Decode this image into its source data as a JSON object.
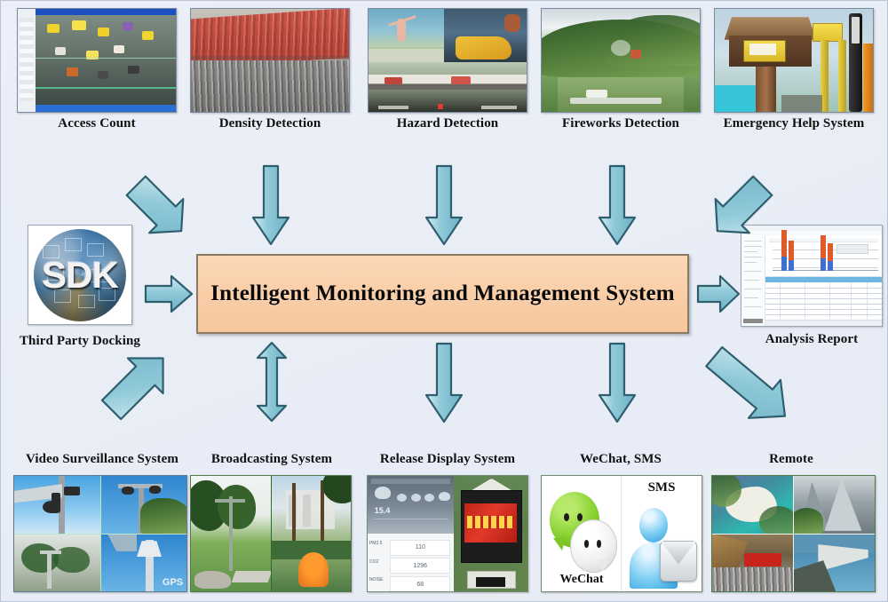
{
  "diagram": {
    "title": "Intelligent Monitoring and Management System",
    "center": {
      "label": "Intelligent Monitoring and Management System"
    },
    "colors": {
      "background": "#eceff7",
      "center_fill": "#f9cda6",
      "center_border": "#8a7a63",
      "arrow_fill": "#8fc9d8",
      "arrow_stroke": "#2f5f6e",
      "caption_text": "#111111",
      "panel_border": "#7a8aa0"
    },
    "top_row": [
      {
        "id": "access-count",
        "label": "Access Count"
      },
      {
        "id": "density-detection",
        "label": "Density Detection"
      },
      {
        "id": "hazard-detection",
        "label": "Hazard Detection"
      },
      {
        "id": "fireworks-detection",
        "label": "Fireworks Detection"
      },
      {
        "id": "emergency-help",
        "label": "Emergency Help System"
      }
    ],
    "left_node": {
      "id": "third-party-docking",
      "label": "Third Party Docking",
      "logo_text": "SDK"
    },
    "right_node": {
      "id": "analysis-report",
      "label": "Analysis Report"
    },
    "bottom_row": [
      {
        "id": "video-surveillance",
        "label": "Video Surveillance System"
      },
      {
        "id": "broadcasting",
        "label": "Broadcasting System"
      },
      {
        "id": "release-display",
        "label": "Release Display System"
      },
      {
        "id": "wechat-sms",
        "label": "WeChat, SMS"
      },
      {
        "id": "remote",
        "label": "Remote"
      }
    ],
    "wechat_panel": {
      "wechat_label": "WeChat",
      "sms_label": "SMS"
    },
    "release_panel": {
      "reading_1": "110",
      "reading_2": "1296",
      "reading_3": "68",
      "temp": "15.4"
    },
    "arrows": [
      {
        "id": "arrow-access-count-to-center",
        "from": "access-count",
        "to": "center",
        "direction": "down-right"
      },
      {
        "id": "arrow-density-detection-to-center",
        "from": "density-detection",
        "to": "center",
        "direction": "down"
      },
      {
        "id": "arrow-hazard-detection-to-center",
        "from": "hazard-detection",
        "to": "center",
        "direction": "down"
      },
      {
        "id": "arrow-fireworks-detection-to-center",
        "from": "fireworks-detection",
        "to": "center",
        "direction": "down"
      },
      {
        "id": "arrow-emergency-help-to-center",
        "from": "emergency-help",
        "to": "center",
        "direction": "down-left"
      },
      {
        "id": "arrow-sdk-to-center",
        "from": "third-party-docking",
        "to": "center",
        "direction": "right"
      },
      {
        "id": "arrow-center-to-analysis-report",
        "from": "center",
        "to": "analysis-report",
        "direction": "right"
      },
      {
        "id": "arrow-video-surveillance-to-center",
        "from": "video-surveillance",
        "to": "center",
        "direction": "up-right"
      },
      {
        "id": "arrow-center-broadcasting",
        "from": "center",
        "to": "broadcasting",
        "direction": "both"
      },
      {
        "id": "arrow-center-to-release-display",
        "from": "center",
        "to": "release-display",
        "direction": "down"
      },
      {
        "id": "arrow-center-to-wechat-sms",
        "from": "center",
        "to": "wechat-sms",
        "direction": "down"
      },
      {
        "id": "arrow-center-to-remote",
        "from": "center",
        "to": "remote",
        "direction": "down-right"
      }
    ]
  }
}
